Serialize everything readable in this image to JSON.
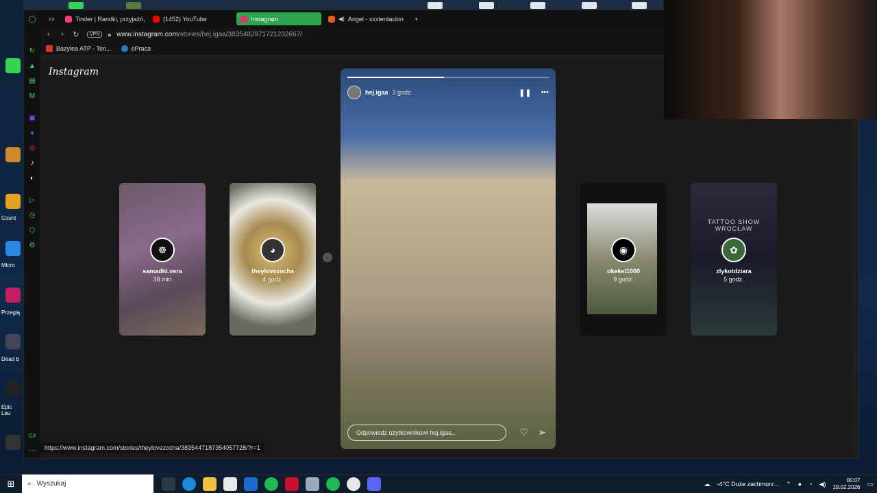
{
  "taskbar": {
    "search_placeholder": "Wyszukaj",
    "weather": "-4°C  Duże zachmurz...",
    "time": "00:07",
    "date": "19.02.2026"
  },
  "desktop": {
    "labels": [
      "Count",
      "Micro",
      "Przeglą",
      "Dead b",
      "Epic",
      "Lau"
    ]
  },
  "browser": {
    "tabs": [
      {
        "label": "Tinder | Randki, przyjaźń,"
      },
      {
        "label": "(1452) YouTube"
      },
      {
        "label": "Instagram"
      },
      {
        "label": "Angel - xxxtentacion"
      }
    ],
    "address": {
      "vpn": "VPN",
      "url_host": "www.instagram.com",
      "url_path": "/stories/hej.igaa/3835482971721232667/"
    },
    "bookmarks": [
      {
        "label": "Bazylea ATP - Ten..."
      },
      {
        "label": "ePraca"
      }
    ],
    "status_url": "https://www.instagram.com/stories/theylovezocha/3835447187354057728/?r=1"
  },
  "instagram": {
    "logo": "Instagram",
    "main_story": {
      "user": "hej.igaa",
      "time": "3 godz.",
      "reply_placeholder": "Odpowiedz użytkownikowi hej.igaa..."
    },
    "stories": [
      {
        "user": "samadhi.vera",
        "time": "38 min"
      },
      {
        "user": "theylovezocha",
        "time": "4 godz."
      },
      {
        "user": "okekel1000",
        "time": "9 godz."
      },
      {
        "user": "zlykotdziara",
        "time": "5 godz."
      }
    ],
    "poster": {
      "title": "TATTOO SHOW WROCŁAW"
    }
  }
}
